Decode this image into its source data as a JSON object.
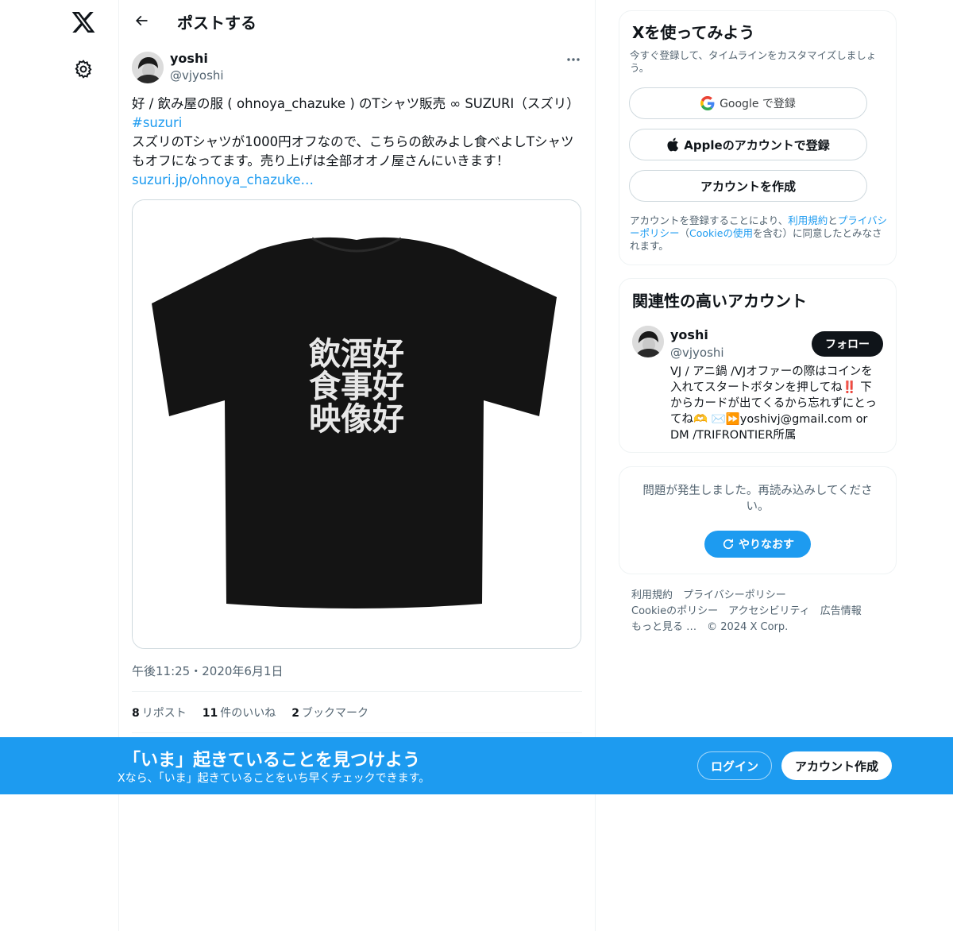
{
  "colors": {
    "accent": "#1d9bf0",
    "text": "#0f1419",
    "muted": "#536471"
  },
  "header": {
    "title": "ポストする"
  },
  "post": {
    "name": "yoshi",
    "handle": "@vjyoshi",
    "line1": "好 / 飲み屋の服 ( ohnoya_chazuke ) のTシャツ販売 ∞ SUZURI（スズリ）",
    "hashtag": "#suzuri",
    "line2": "スズリのTシャツが1000円オフなので、こちらの飲みよし食べよしTシャツもオフになってます。売り上げは全部オオノ屋さんにいきます！",
    "link": "suzuri.jp/ohnoya_chazuke…",
    "shirt_text": [
      "飲酒好",
      "食事好",
      "映像好"
    ],
    "timestamp": "午後11:25・2020年6月1日",
    "stats": [
      {
        "count": "8",
        "label": "リポスト"
      },
      {
        "count": "11",
        "label": "件のいいね"
      },
      {
        "count": "2",
        "label": "ブックマーク"
      }
    ]
  },
  "signup": {
    "title": "Xを使ってみよう",
    "subtitle": "今すぐ登録して、タイムラインをカスタマイズしましょう。",
    "google": "Google で登録",
    "apple": "Appleのアカウントで登録",
    "create": "アカウントを作成",
    "legal_1": "アカウントを登録することにより、",
    "legal_terms": "利用規約",
    "legal_2": "と",
    "legal_privacy": "プライバシーポリシー",
    "legal_3": "（",
    "legal_cookie": "Cookieの使用",
    "legal_4": "を含む）に同意したとみなされます。"
  },
  "related": {
    "title": "関連性の高いアカウント",
    "name": "yoshi",
    "handle": "@vjyoshi",
    "follow": "フォロー",
    "bio": "VJ / アニ鍋 /VJオファーの際はコインを入れてスタートボタンを押してね‼️ 下からカードが出てくるから忘れずにとってね🫶 ✉️⏩yoshivj@gmail.com or DM /TRIFRONTIER所属"
  },
  "error": {
    "message": "問題が発生しました。再読み込みしてください。",
    "retry": "やりなおす"
  },
  "footer": {
    "links": [
      "利用規約",
      "プライバシーポリシー",
      "Cookieのポリシー",
      "アクセシビリティ",
      "広告情報",
      "もっと見る …",
      "© 2024 X Corp."
    ]
  },
  "banner": {
    "title": "「いま」起きていることを見つけよう",
    "subtitle": "Xなら、「いま」起きていることをいち早くチェックできます。",
    "login": "ログイン",
    "create": "アカウント作成"
  }
}
